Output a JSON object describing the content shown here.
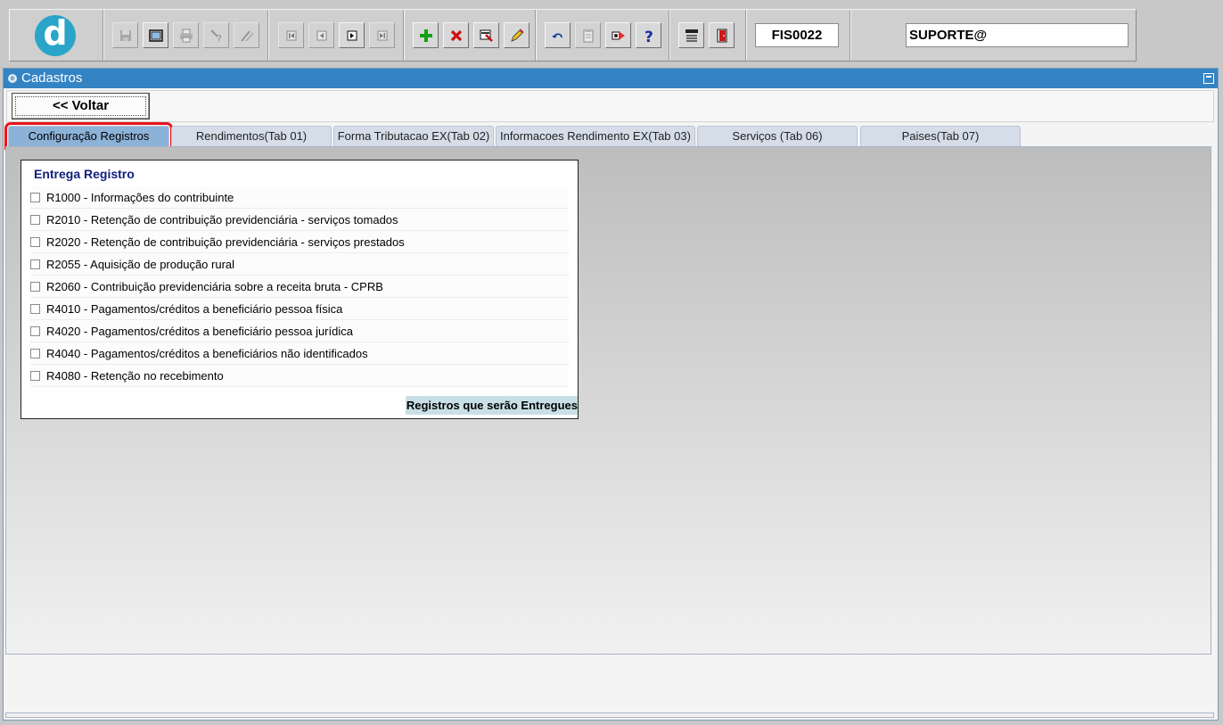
{
  "toolbar": {
    "logo_letter": "d",
    "form_code": "FIS0022",
    "user": "SUPORTE@"
  },
  "window": {
    "title": "Cadastros",
    "back_button": "<< Voltar"
  },
  "tabs": [
    {
      "label": "Configuração Registros",
      "active": true
    },
    {
      "label": "Rendimentos(Tab 01)"
    },
    {
      "label": "Forma Tributacao EX(Tab 02)"
    },
    {
      "label": "Informacoes Rendimento EX(Tab 03)"
    },
    {
      "label": "Serviços (Tab 06)"
    },
    {
      "label": "Paises(Tab 07)"
    }
  ],
  "panel": {
    "title": "Entrega Registro",
    "items": [
      {
        "label": "R1000 - Informações do contribuinte"
      },
      {
        "label": "R2010 - Retenção de contribuição previdenciária - serviços tomados"
      },
      {
        "label": "R2020 - Retenção de contribuição previdenciária - serviços prestados"
      },
      {
        "label": "R2055 - Aquisição de produção rural"
      },
      {
        "label": "R2060 - Contribuição previdenciária sobre a receita bruta - CPRB"
      },
      {
        "label": "R4010 - Pagamentos/créditos a beneficiário pessoa física"
      },
      {
        "label": "R4020 - Pagamentos/créditos a beneficiário pessoa jurídica"
      },
      {
        "label": "R4040 - Pagamentos/créditos a beneficiários não identificados"
      },
      {
        "label": "R4080 - Retenção no recebimento"
      }
    ],
    "footer": "Registros que serão Entregues"
  },
  "colors": {
    "titlebar": "#3484c4",
    "active_tab": "#8cb2d7",
    "highlight": "#e8131c"
  }
}
